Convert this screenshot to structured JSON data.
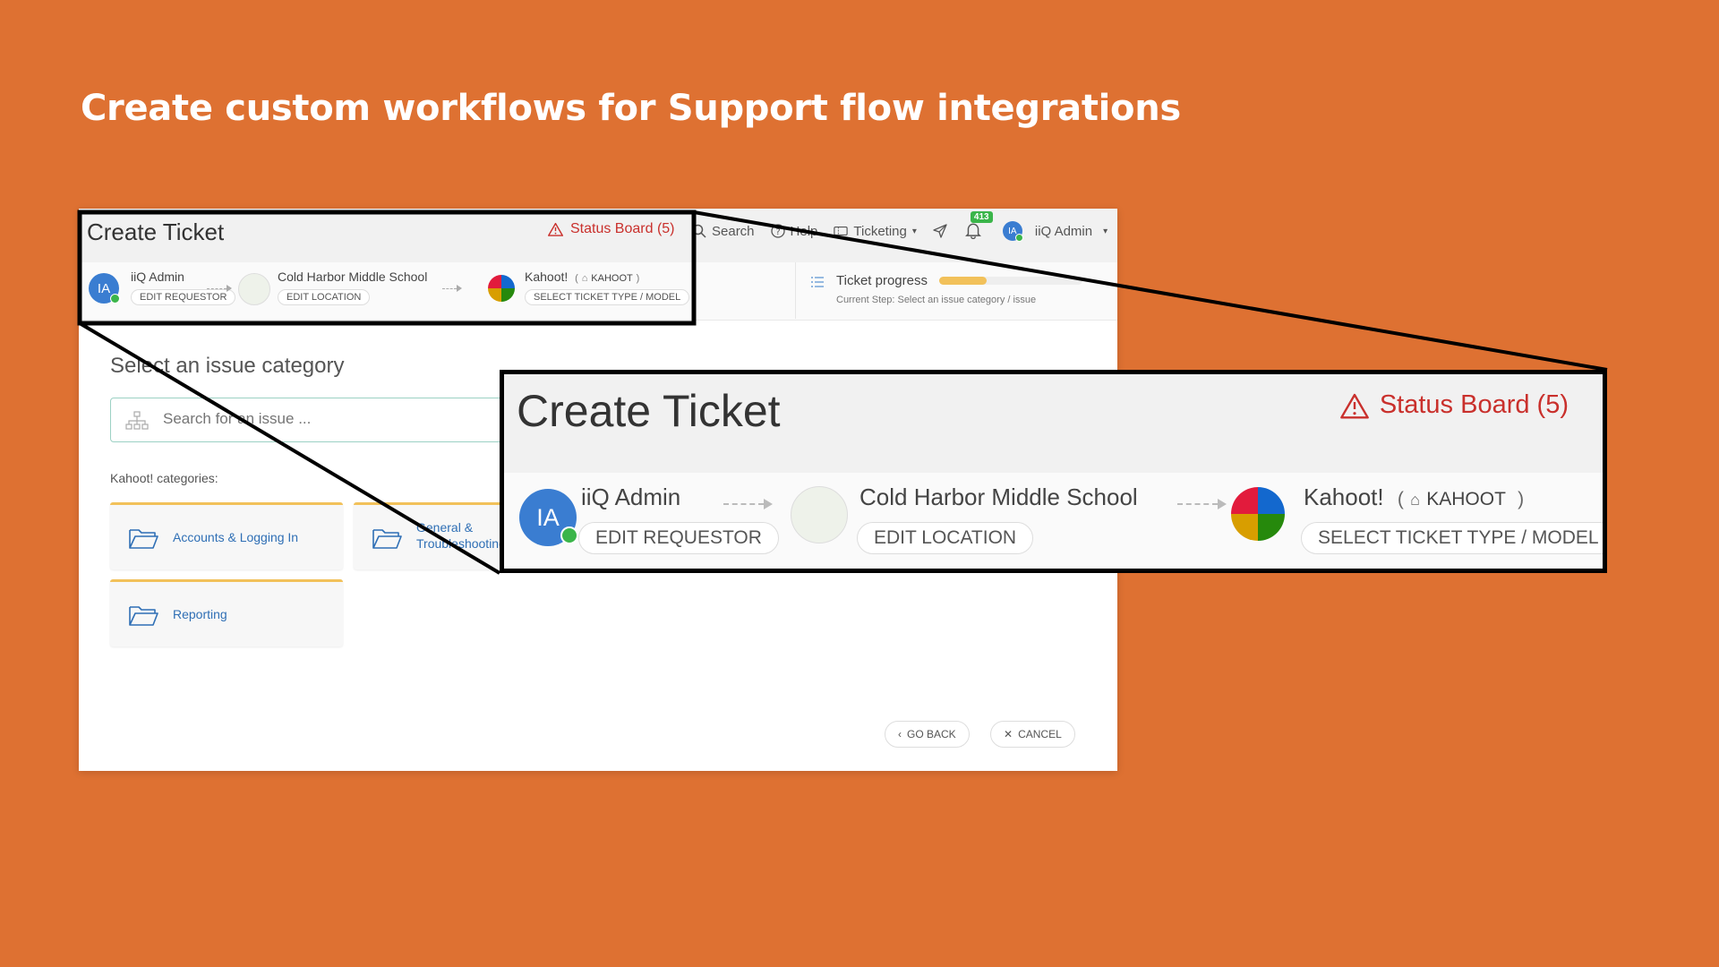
{
  "slide": {
    "title": "Create custom workflows for Support flow integrations"
  },
  "app": {
    "title": "Create Ticket",
    "status_board": "Status Board (5)",
    "nav": {
      "search": "Search",
      "help": "Help",
      "ticketing": "Ticketing",
      "notifications_count": "413",
      "user_initials": "IA",
      "user_name": "iiQ Admin"
    },
    "breadcrumbs": {
      "requestor": {
        "initials": "IA",
        "name": "iiQ Admin",
        "button": "EDIT REQUESTOR"
      },
      "location": {
        "name": "Cold Harbor Middle School",
        "button": "EDIT LOCATION"
      },
      "product": {
        "name": "Kahoot!",
        "open_paren": "(",
        "tag": "KAHOOT",
        "close_paren": ")",
        "button": "SELECT TICKET TYPE / MODEL"
      }
    },
    "progress": {
      "label": "Ticket progress",
      "current_step": "Current Step: Select an issue category / issue",
      "percent": 33
    },
    "issue": {
      "heading": "Select an issue category",
      "search_placeholder": "Search for an issue ...",
      "categories_label": "Kahoot! categories:",
      "categories": [
        "Accounts & Logging In",
        "General & Troubleshooting",
        "Reporting"
      ]
    },
    "footer": {
      "go_back": "GO BACK",
      "cancel": "CANCEL"
    }
  },
  "colors": {
    "background": "#DE7132",
    "status_red": "#C9302C",
    "link_blue": "#2F6FB5",
    "avatar_blue": "#3A7DD1",
    "online_green": "#3BB54A",
    "accent_yellow": "#F2C15A"
  },
  "icons": {
    "status": "warning-triangle-icon",
    "search": "search-icon",
    "help": "help-circle-icon",
    "ticketing": "ticket-icon",
    "send": "send-icon",
    "bell": "bell-icon",
    "tag": "tag-icon",
    "category": "folder-open-icon",
    "search_field": "hierarchy-icon",
    "progress": "list-icon"
  }
}
